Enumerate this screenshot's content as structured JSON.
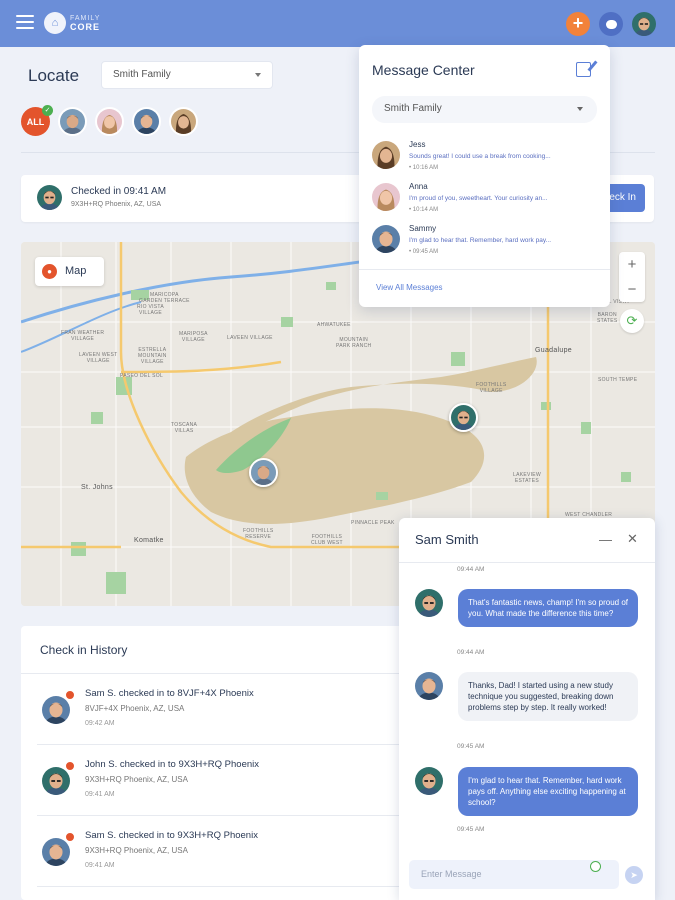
{
  "app": {
    "logo_top": "FAMILY",
    "logo_bottom": "CORE"
  },
  "header": {
    "plus_label": "+"
  },
  "locate": {
    "title": "Locate",
    "family_select": "Smith Family"
  },
  "filter": {
    "all_label": "ALL",
    "check": "✓"
  },
  "checkin": {
    "title": "Checked in 09:41 AM",
    "address": "9X3H+RQ Phoenix, AZ, USA",
    "button": "Check In"
  },
  "map": {
    "label": "Map",
    "zoom_in": "+",
    "zoom_out": "−",
    "refresh": "⟳",
    "places": {
      "maricopa": "MARICOPA\nGARDEN TERRACE",
      "rio_vista": "RIO VISTA\nVILLAGE",
      "mariposa": "MARIPOSA\nVILLAGE",
      "fran_weather": "FRAN WEATHER\nVILLAGE",
      "laveen_west": "LAVEEN WEST\nVILLAGE",
      "laveen_village": "LAVEEN VILLAGE",
      "estrella_mtn": "ESTRELLA\nMOUNTAIN\nVILLAGE",
      "paseo_del_sol": "PASEO DEL SOL",
      "toscana": "TOSCANA\nVILLAS",
      "mountain_park": "MOUNTAIN\nPARK RANCH",
      "ahwatukee": "AHWATUKEE",
      "st_johns": "St. Johns",
      "komatke": "Komatke",
      "foothills_reserve": "FOOTHILLS\nRESERVE",
      "foothills_club": "FOOTHILLS\nCLUB WEST",
      "pinnacle_peak": "PINNACLE PEAK",
      "guadalupe": "Guadalupe",
      "south_tempe": "SOUTH TEMPE",
      "west_chandler": "WEST CHANDLER",
      "carol_vista": "CAROL VISTA",
      "foothills_village": "FOOTHILLS\nVILLAGE",
      "baron": "BARON\nSTATES",
      "lakeview": "LAKEVIEW\nESTATES"
    }
  },
  "message_center": {
    "title": "Message Center",
    "family_select": "Smith Family",
    "messages": [
      {
        "name": "Jess",
        "preview": "Sounds great! I could use a break from cooking...",
        "time": "• 10:16 AM"
      },
      {
        "name": "Anna",
        "preview": "I'm proud of you, sweetheart. Your curiosity an...",
        "time": "• 10:14 AM"
      },
      {
        "name": "Sammy",
        "preview": "I'm glad to hear that. Remember, hard work pay...",
        "time": "• 09:45 AM"
      }
    ],
    "view_all": "View All Messages"
  },
  "history": {
    "title": "Check in History",
    "items": [
      {
        "title": "Sam S. checked in to 8VJF+4X Phoenix",
        "address": "8VJF+4X Phoenix, AZ, USA",
        "time": "09:42 AM"
      },
      {
        "title": "John S. checked in to 9X3H+RQ Phoenix",
        "address": "9X3H+RQ Phoenix, AZ, USA",
        "time": "09:41 AM"
      },
      {
        "title": "Sam S. checked in to 9X3H+RQ Phoenix",
        "address": "9X3H+RQ Phoenix, AZ, USA",
        "time": "09:41 AM"
      }
    ]
  },
  "chat": {
    "title": "Sam Smith",
    "minimize": "—",
    "close": "✕",
    "messages": [
      {
        "time": "09:44 AM"
      },
      {
        "text": "That's fantastic news, champ! I'm so proud of you. What made the difference this time?",
        "time": "09:44 AM"
      },
      {
        "text": "Thanks, Dad! I started using a new study technique you suggested, breaking down problems step by step. It really worked!",
        "time": "09:45 AM"
      },
      {
        "text": "I'm glad to hear that. Remember, hard work pays off.  Anything else exciting happening at school?",
        "time": "09:45 AM"
      }
    ],
    "input_placeholder": "Enter Message",
    "send": "➤"
  },
  "colors": {
    "header": "#6b8ed8",
    "accent": "#5b7fd6",
    "orange": "#f2823a",
    "alert": "#e3542c",
    "green": "#4caf50"
  }
}
